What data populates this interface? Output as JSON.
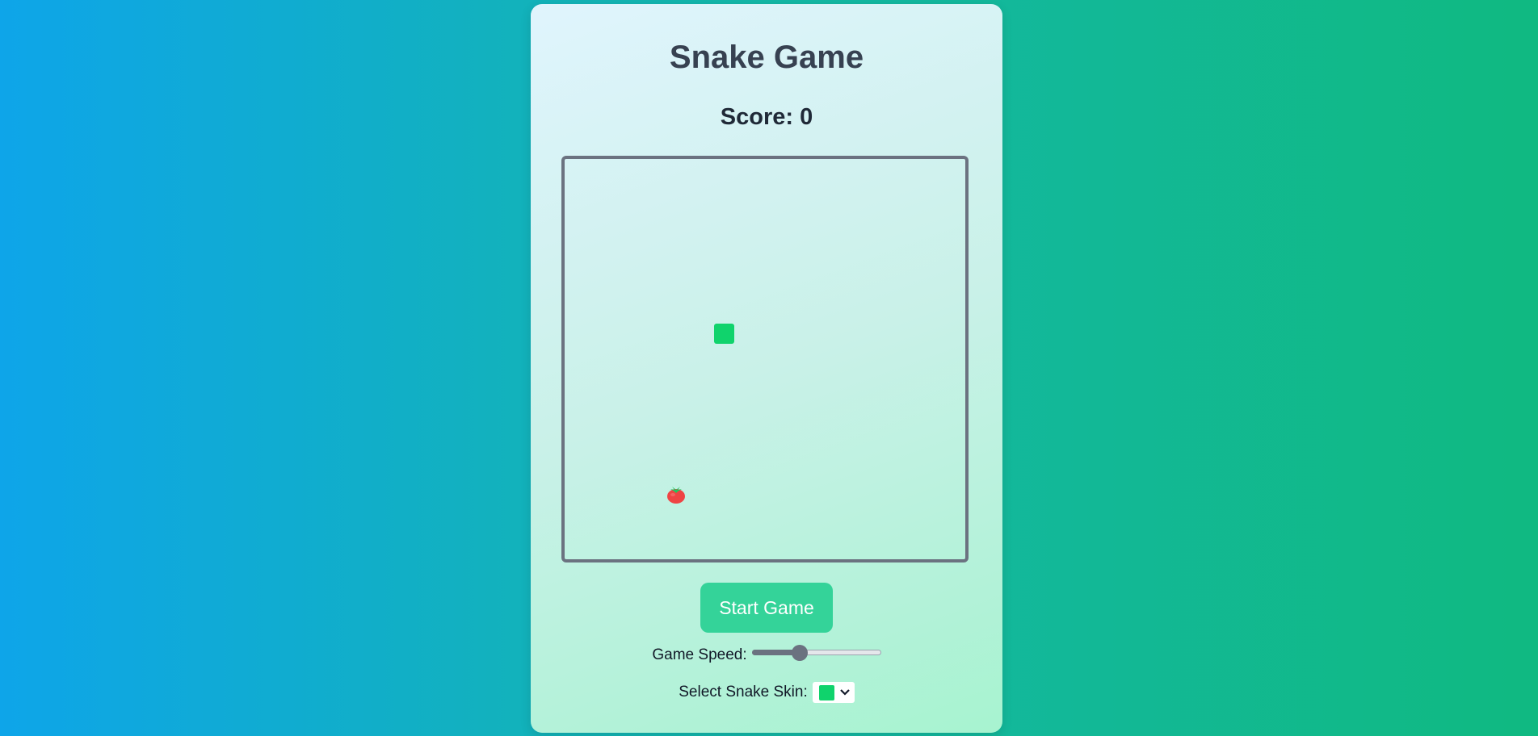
{
  "title": "Snake Game",
  "score": {
    "label": "Score: 0",
    "value": 0
  },
  "board": {
    "snake_color": "#10d36c",
    "food_icon": "tomato-icon",
    "food_color": "#ef4444",
    "border_color": "#6b7280"
  },
  "controls": {
    "start_label": "Start Game",
    "start_color": "#34d399",
    "speed_label": "Game Speed:",
    "speed_fraction": 0.35,
    "skin_label": "Select Snake Skin:",
    "skin_selected_color": "#10d36c",
    "skin_icon": "chevron-down-icon"
  },
  "colors": {
    "page_gradient_start": "#0ea5e9",
    "page_gradient_end": "#10b981",
    "title_color": "#374151"
  }
}
